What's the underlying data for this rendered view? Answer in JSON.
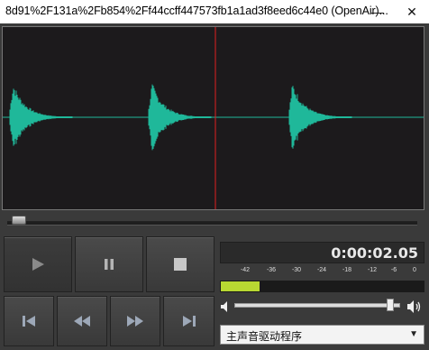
{
  "window": {
    "title": "8d91%2F131a%2Fb854%2Ff44ccff447573fb1a1ad3f8eed6c44e0 (OpenAir)...",
    "minimize_icon": "minimize-icon",
    "close_icon": "close-icon"
  },
  "waveform": {
    "color": "#1fb89a",
    "playhead_color": "#e02020",
    "background": "#1c1a1c",
    "playhead_position_fraction": 0.5
  },
  "seekbar": {
    "position_fraction": 0.01
  },
  "transport": {
    "play_icon": "play-icon",
    "pause_icon": "pause-icon",
    "stop_icon": "stop-icon",
    "skip_back_icon": "skip-to-start-icon",
    "rewind_icon": "rewind-icon",
    "fast_forward_icon": "fast-forward-icon",
    "skip_forward_icon": "skip-to-end-icon"
  },
  "time_display": "0:00:02.05",
  "level_meter": {
    "scale_labels": [
      "-42",
      "-36",
      "-30",
      "-24",
      "-18",
      "-12",
      "-6",
      "0"
    ],
    "level_fraction": 0.19,
    "fill_color": "#b8d832"
  },
  "volume": {
    "level_fraction": 0.95,
    "mute_icon": "speaker-mute-icon",
    "loud_icon": "speaker-loud-icon"
  },
  "audio_device": {
    "selected": "主声音驱动程序"
  }
}
